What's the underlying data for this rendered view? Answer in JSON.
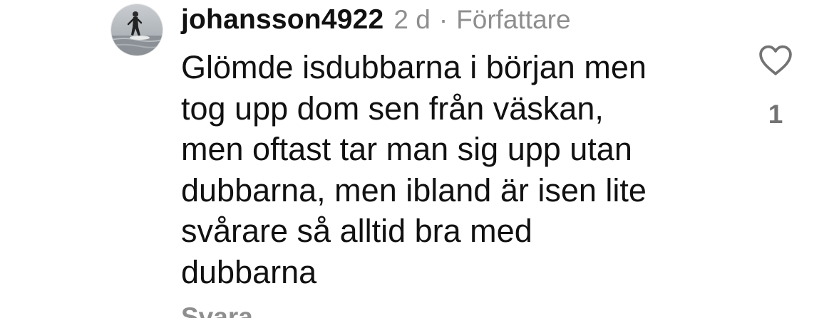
{
  "comment": {
    "username": "johansson4922",
    "time": "2 d",
    "separator": "·",
    "role": "Författare",
    "lines": [
      "Glömde isdubbarna i början men",
      "tog upp dom sen från väskan,",
      "men oftast tar man sig upp utan",
      "dubbarna, men ibland är isen lite",
      "svårare så alltid bra med",
      "dubbarna"
    ],
    "like_count": "1",
    "like_icon": "heart-outline-icon",
    "reply_label": "Svara"
  },
  "colors": {
    "text": "#111111",
    "muted": "#8e8e8e",
    "icon": "#737373",
    "background": "#ffffff"
  }
}
